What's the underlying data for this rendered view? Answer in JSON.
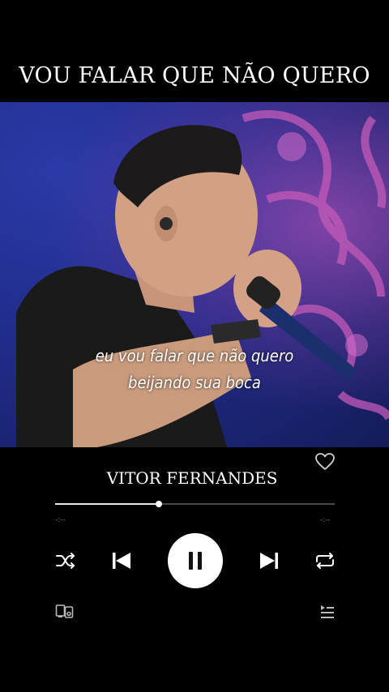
{
  "header": {
    "song_title": "VOU FALAR QUE NÃO QUERO"
  },
  "video": {
    "lyrics": [
      "eu vou falar que não quero",
      "beijando sua boca"
    ]
  },
  "player": {
    "artist": "VITOR FERNANDES",
    "progress": 0.37,
    "time_elapsed": "-:--",
    "time_remaining": "-:--",
    "liked": false,
    "state": "playing",
    "icons": [
      "heart-icon",
      "shuffle-icon",
      "previous-icon",
      "pause-icon",
      "next-icon",
      "repeat-icon",
      "devices-icon",
      "queue-icon"
    ],
    "colors": {
      "background": "#000000",
      "accent": "#ffffff",
      "track": "#4a4a4a"
    }
  }
}
